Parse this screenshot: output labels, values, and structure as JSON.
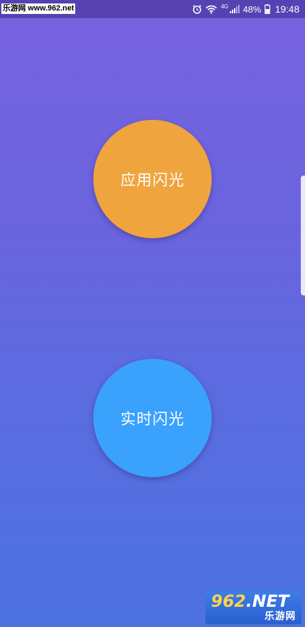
{
  "status_bar": {
    "watermark": "乐游网 www.962.net",
    "network_type": "4G",
    "battery": "48%",
    "time": "19:48",
    "icons": [
      "alarm-icon",
      "wifi-icon",
      "signal-icon",
      "battery-icon"
    ]
  },
  "main": {
    "apply_flash_label": "应用闪光",
    "realtime_flash_label": "实时闪光"
  },
  "watermark_logo": {
    "brand_prefix": "962",
    "brand_suffix": ".NET",
    "brand_cn": "乐游网"
  },
  "colors": {
    "background_top": "#7862df",
    "background_bottom": "#4c72df",
    "apply_button": "#efa43e",
    "realtime_button": "#3aa2fc"
  }
}
